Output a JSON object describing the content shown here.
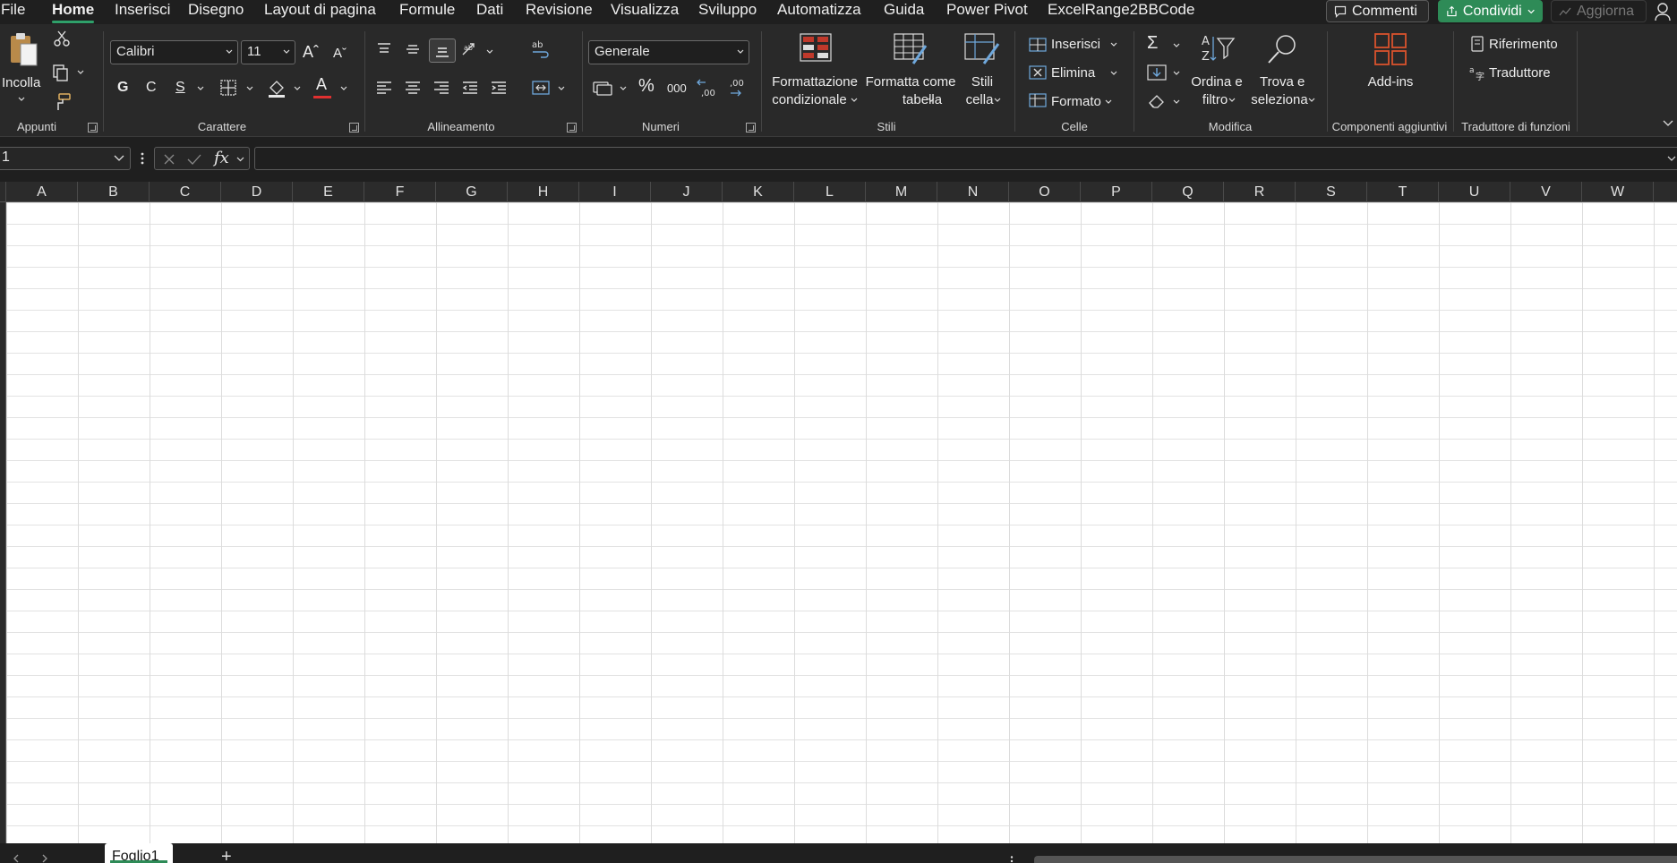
{
  "menu": {
    "items": [
      "File",
      "Home",
      "Inserisci",
      "Disegno",
      "Layout di pagina",
      "Formule",
      "Dati",
      "Revisione",
      "Visualizza",
      "Sviluppo",
      "Automatizza",
      "Guida",
      "Power Pivot",
      "ExcelRange2BBCode"
    ],
    "active": "Home",
    "comments_label": "Commenti",
    "share_label": "Condividi",
    "update_label": "Aggiorna"
  },
  "ribbon": {
    "clipboard": {
      "paste_label": "Incolla",
      "group_label": "Appunti"
    },
    "font": {
      "font_name": "Calibri",
      "font_size": "11",
      "bold": "G",
      "italic": "C",
      "underline": "S",
      "group_label": "Carattere"
    },
    "alignment": {
      "group_label": "Allineamento"
    },
    "number": {
      "format": "Generale",
      "percent": "%",
      "thousands": "000",
      "group_label": "Numeri"
    },
    "styles": {
      "conditional_line1": "Formattazione",
      "conditional_line2": "condizionale",
      "table_line1": "Formatta come",
      "table_line2": "tabella",
      "cellstyles_line1": "Stili",
      "cellstyles_line2": "cella",
      "group_label": "Stili"
    },
    "cells": {
      "insert": "Inserisci",
      "delete": "Elimina",
      "format": "Formato",
      "group_label": "Celle"
    },
    "editing": {
      "sort_line1": "Ordina e",
      "sort_line2": "filtro",
      "find_line1": "Trova e",
      "find_line2": "seleziona",
      "group_label": "Modifica"
    },
    "addins": {
      "label": "Add-ins",
      "group_label": "Componenti aggiuntivi"
    },
    "translator": {
      "reference": "Riferimento",
      "translator": "Traduttore",
      "group_label": "Traduttore di funzioni"
    }
  },
  "formula_bar": {
    "name_box": "1",
    "fx": "fx",
    "formula": ""
  },
  "columns": [
    "A",
    "B",
    "C",
    "D",
    "E",
    "F",
    "G",
    "H",
    "I",
    "J",
    "K",
    "L",
    "M",
    "N",
    "O",
    "P",
    "Q",
    "R",
    "S",
    "T",
    "U",
    "V",
    "W"
  ],
  "sheets": {
    "active": "Foglio1",
    "add_label": "+"
  },
  "colors": {
    "accent_green": "#2e8b57",
    "conditional_red": "#c0392b",
    "font_color_red": "#e03030"
  }
}
